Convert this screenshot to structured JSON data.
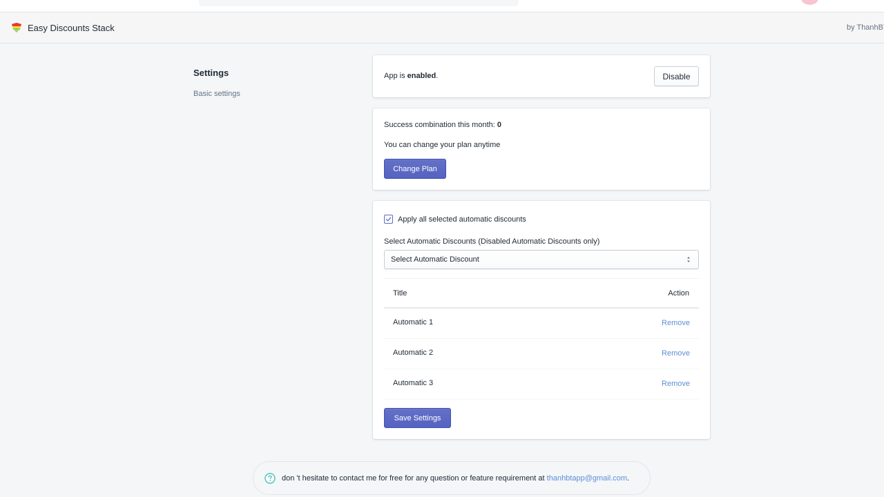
{
  "app": {
    "title": "Easy Discounts Stack",
    "byline": "by ThanhBT"
  },
  "sidebar": {
    "section_title": "Settings",
    "section_description": "Basic settings"
  },
  "status_card": {
    "prefix": "App is ",
    "state": "enabled",
    "suffix": ".",
    "disable_label": "Disable"
  },
  "plan_card": {
    "usage_label": "Success combination this month: ",
    "usage_count": "0",
    "note": "You can change your plan anytime",
    "change_plan_label": "Change Plan"
  },
  "discounts_card": {
    "apply_all_label": "Apply all selected automatic discounts",
    "apply_all_checked": true,
    "select_label": "Select Automatic Discounts (Disabled Automatic Discounts only)",
    "select_value": "Select Automatic Discount",
    "table": {
      "columns": [
        "Title",
        "Action"
      ],
      "rows": [
        {
          "title": "Automatic 1",
          "action": "Remove"
        },
        {
          "title": "Automatic 2",
          "action": "Remove"
        },
        {
          "title": "Automatic 3",
          "action": "Remove"
        }
      ]
    },
    "save_label": "Save Settings"
  },
  "footer": {
    "help_text": "don 't hesitate to contact me for free for any question or feature requirement at ",
    "email": "thanhbtapp@gmail.com",
    "suffix": "."
  },
  "colors": {
    "primary": "#5c6ac4",
    "link": "#5c8ed6",
    "help_icon": "#47c1bf",
    "background": "#f4f6f8"
  }
}
